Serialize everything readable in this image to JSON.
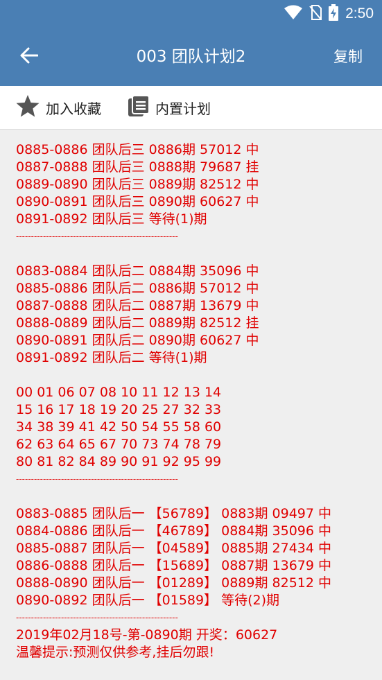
{
  "status_bar": {
    "time": "2:50",
    "icons": [
      "wifi-icon",
      "no-sim-icon",
      "battery-charging-icon"
    ]
  },
  "app_bar": {
    "back_icon": "arrow-left-icon",
    "title": "003 团队计划2",
    "copy_label": "复制"
  },
  "toolbar": {
    "favorite_label": "加入收藏",
    "favorite_icon": "star-icon",
    "builtin_label": "内置计划",
    "builtin_icon": "documents-icon"
  },
  "colors": {
    "primary": "#4a7fb4",
    "text_red": "#e00000",
    "background": "#efefef"
  },
  "plan": {
    "section1": [
      "0885-0886 团队后三 0886期 57012 中",
      "0887-0888 团队后三 0888期 79687 挂",
      "0889-0890 团队后三 0889期 82512 中",
      "0890-0891 团队后三 0890期 60627 中",
      "0891-0892 团队后三 等待(1)期"
    ],
    "separator": "------------------------------------------------------",
    "section2": [
      "0883-0884 团队后二 0884期 35096 中",
      "0885-0886 团队后二 0886期 57012 中",
      "0887-0888 团队后二 0887期 13679 中",
      "0888-0889 团队后二 0889期 82512 挂",
      "0890-0891 团队后二 0890期 60627 中",
      "0891-0892 团队后二 等待(1)期"
    ],
    "numbers": [
      "00 01 06 07 08 10 11 12 13 14",
      "15 16 17 18 19 20 25 27 32 33",
      "34 38 39 41 42 50 54 55 58 60",
      "62 63 64 65 67 70 73 74 78 79",
      "80 81 82 84 89 90 91 92 95 99"
    ],
    "section3": [
      "0883-0885 团队后一 【56789】 0883期 09497 中",
      "0884-0886 团队后一 【46789】 0884期 35096 中",
      "0885-0887 团队后一 【04589】 0885期 27434 中",
      "0886-0888 团队后一 【15689】 0887期 13679 中",
      "0888-0890 团队后一 【01289】 0889期 82512 中",
      "0890-0892 团队后一 【01589】 等待(2)期"
    ],
    "footer_draw": "2019年02月18号-第-0890期 开奖：60627",
    "footer_tip": "温馨提示:预测仅供参考,挂后勿跟!"
  }
}
